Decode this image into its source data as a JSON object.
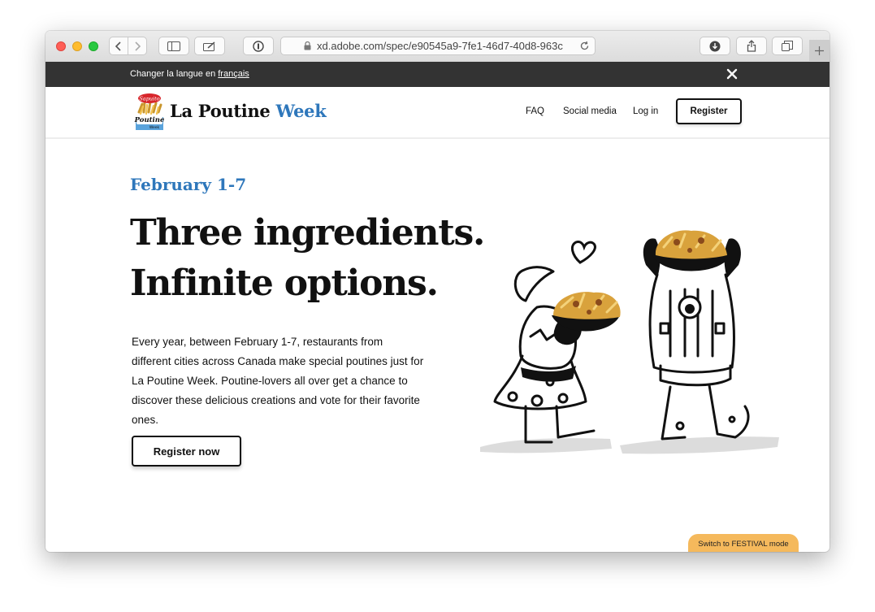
{
  "browser": {
    "url": "xd.adobe.com/spec/e90545a9-7fe1-46d7-40d8-963c"
  },
  "lang_bar": {
    "text": "Changer la langue en ",
    "link": "français"
  },
  "header": {
    "logo": {
      "badge": "Sapuito",
      "name": "Poutine",
      "sub": "Week"
    },
    "brand_main": "La Poutine ",
    "brand_accent": "Week",
    "nav": [
      "FAQ",
      "Social media",
      "Log in"
    ],
    "register": "Register"
  },
  "hero": {
    "date": "February 1-7",
    "headline_1": "Three ingredients.",
    "headline_2": "Infinite options.",
    "description": "Every year, between February 1-7, restaurants from different cities across Canada make special poutines just for La Poutine Week. Poutine-lovers all over get a chance to discover these delicious creations and vote for their favorite ones.",
    "cta": "Register now"
  },
  "festival_toggle": "Switch to FESTIVAL mode",
  "colors": {
    "accent": "#2e77bb",
    "dark_bar": "#333333",
    "festival": "#f5b95c"
  }
}
